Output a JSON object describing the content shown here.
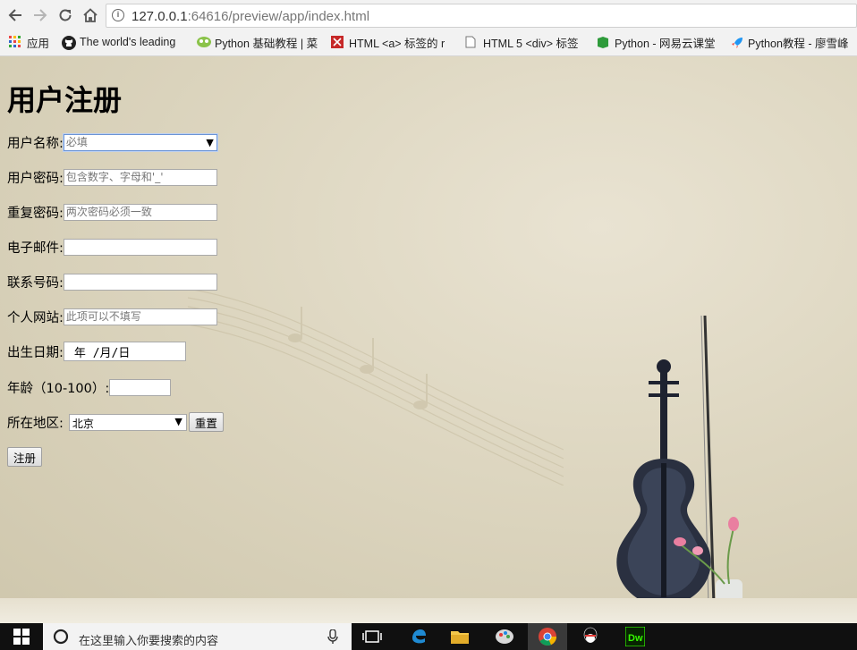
{
  "browser": {
    "url_host": "127.0.0.1",
    "url_rest": ":64616/preview/app/index.html",
    "bookmarks": [
      {
        "label": "应用",
        "icon": "apps-grid-icon"
      },
      {
        "label": "The world's leading",
        "icon": "github-icon"
      },
      {
        "label": "Python 基础教程 | 菜",
        "icon": "runoob-icon"
      },
      {
        "label": "HTML <a> 标签的 r",
        "icon": "w3school-icon"
      },
      {
        "label": "HTML 5 <div> 标签",
        "icon": "page-icon"
      },
      {
        "label": "Python - 网易云课堂",
        "icon": "netease-icon"
      },
      {
        "label": "Python教程 - 廖雪峰",
        "icon": "rocket-icon"
      }
    ]
  },
  "form": {
    "title": "用户注册",
    "fields": {
      "username": {
        "label": "用户名称:",
        "placeholder": "必填"
      },
      "password": {
        "label": "用户密码:",
        "placeholder": "包含数字、字母和'_'"
      },
      "repeat": {
        "label": "重复密码:",
        "placeholder": "两次密码必须一致"
      },
      "email": {
        "label": "电子邮件:",
        "placeholder": ""
      },
      "phone": {
        "label": "联系号码:",
        "placeholder": ""
      },
      "website": {
        "label": "个人网站:",
        "placeholder": "此项可以不填写"
      },
      "birthday": {
        "label": "出生日期:",
        "value": "年 /月/日"
      },
      "age": {
        "label": "年龄（10-100）:",
        "value": ""
      },
      "region": {
        "label": "所在地区:",
        "selected": "北京"
      }
    },
    "reset_label": "重置",
    "submit_label": "注册"
  },
  "taskbar": {
    "search_placeholder": "在这里输入你要搜索的内容"
  }
}
